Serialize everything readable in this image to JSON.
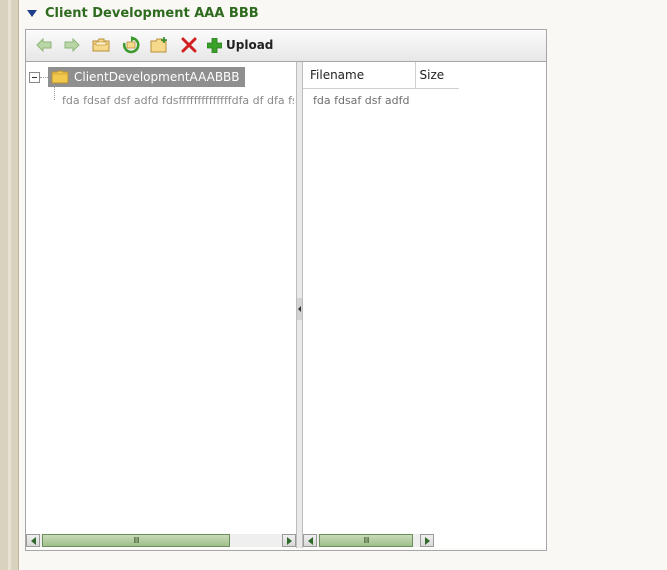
{
  "section": {
    "title": "Client Development AAA BBB"
  },
  "toolbar": {
    "back_icon": "back-arrow-icon",
    "forward_icon": "forward-arrow-icon",
    "open_icon": "open-folder-icon",
    "refresh_icon": "refresh-icon",
    "new_folder_icon": "new-folder-icon",
    "delete_icon": "delete-icon",
    "upload_label": "Upload"
  },
  "tree": {
    "root_label": "ClientDevelopmentAAABBB",
    "child_label": "fda fdsaf dsf adfd fdsffffffffffffffdfa df dfa fs"
  },
  "files": {
    "columns": [
      "Filename",
      "Size"
    ],
    "rows": [
      {
        "name": "fda fdsaf dsf adfd fdsffffffffffffffdfa df dfa fs"
      }
    ]
  },
  "colors": {
    "title_green": "#2e6b1f",
    "root_bg": "#8f8f8f",
    "folder_yellow": "#f2c94c"
  }
}
